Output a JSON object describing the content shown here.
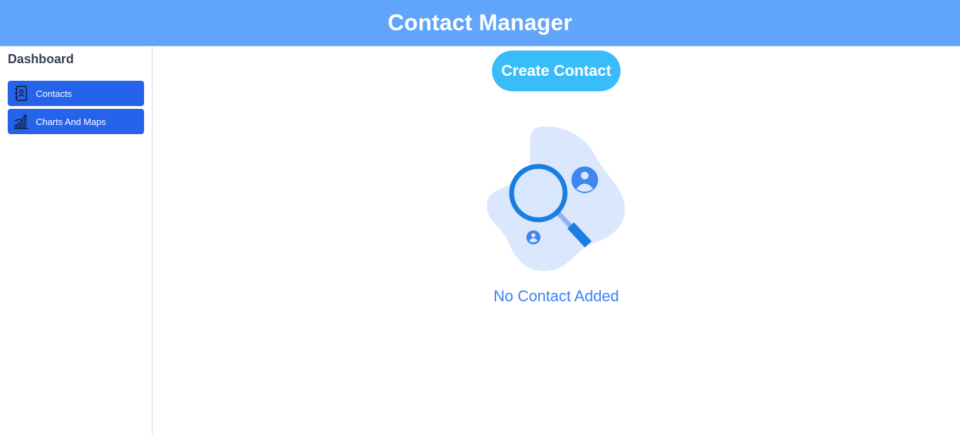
{
  "header": {
    "title": "Contact Manager"
  },
  "sidebar": {
    "title": "Dashboard",
    "items": [
      {
        "label": "Contacts",
        "icon": "contacts-book-icon"
      },
      {
        "label": "Charts And Maps",
        "icon": "chart-growth-icon"
      }
    ]
  },
  "main": {
    "create_button_label": "Create Contact",
    "empty_state_text": "No Contact Added",
    "empty_state_icon": "search-contacts-illustration"
  },
  "colors": {
    "header_bg": "#60a5fa",
    "nav_item_bg": "#2563eb",
    "create_button_bg": "#38bdf8",
    "empty_text": "#3b82f6"
  }
}
